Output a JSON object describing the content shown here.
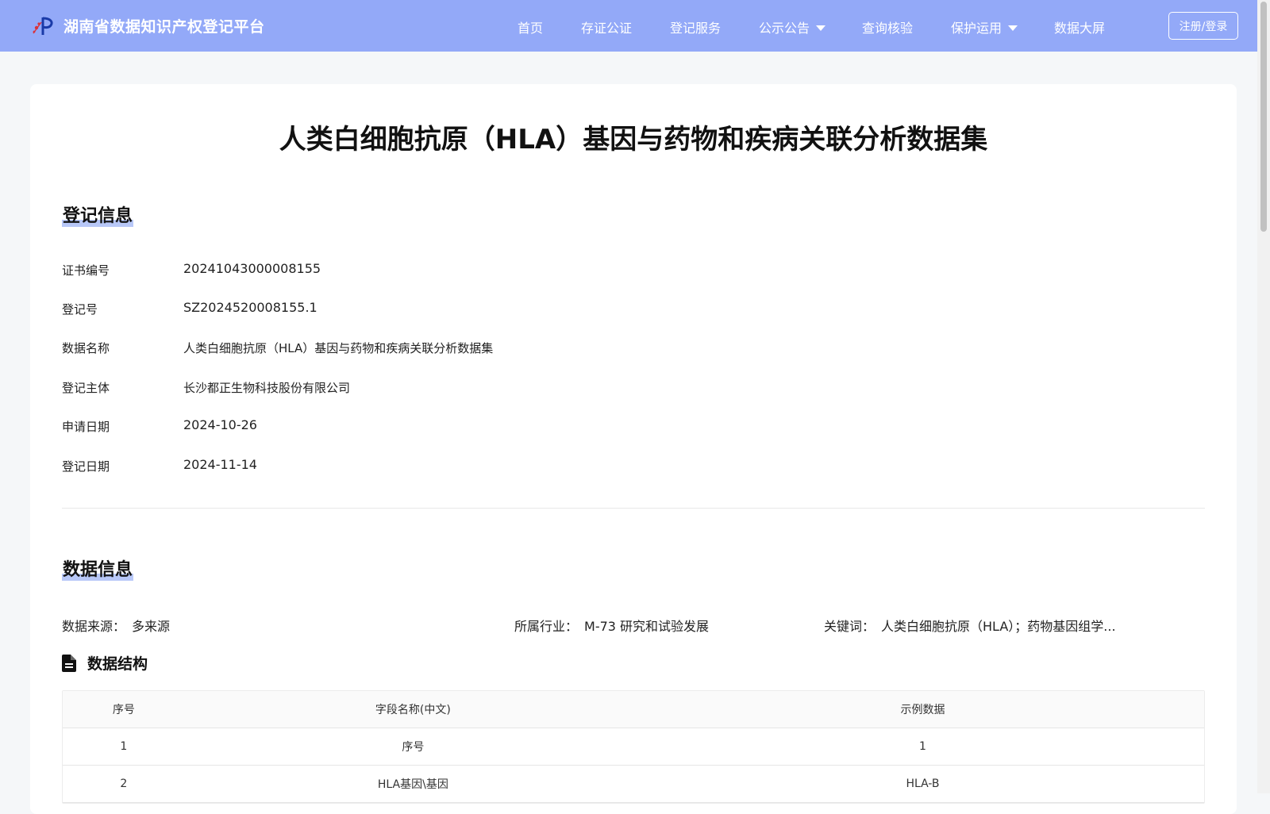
{
  "header": {
    "site_title": "湖南省数据知识产权登记平台",
    "nav": [
      {
        "label": "首页"
      },
      {
        "label": "存证公证"
      },
      {
        "label": "登记服务"
      },
      {
        "label": "公示公告",
        "dropdown": true
      },
      {
        "label": "查询核验"
      },
      {
        "label": "保护运用",
        "dropdown": true
      },
      {
        "label": "数据大屏"
      }
    ],
    "login_label": "注册/登录"
  },
  "colors": {
    "header_bg": "#93a9f8",
    "section_highlight": "#b8c8f8",
    "page_bg": "#f5f7f9"
  },
  "main": {
    "title": "人类白细胞抗原（HLA）基因与药物和疾病关联分析数据集",
    "registration": {
      "section_title": "登记信息",
      "fields": [
        {
          "label": "证书编号",
          "value": "20241043000008155"
        },
        {
          "label": "登记号",
          "value": "SZ2024520008155.1"
        },
        {
          "label": "数据名称",
          "value": "人类白细胞抗原（HLA）基因与药物和疾病关联分析数据集"
        },
        {
          "label": "登记主体",
          "value": "长沙都正生物科技股份有限公司"
        },
        {
          "label": "申请日期",
          "value": "2024-10-26"
        },
        {
          "label": "登记日期",
          "value": "2024-11-14"
        }
      ]
    },
    "data_info": {
      "section_title": "数据信息",
      "source_label": "数据来源：",
      "source_value": "多来源",
      "industry_label": "所属行业：",
      "industry_value": "M-73 研究和试验发展",
      "keywords_label": "关键词：",
      "keywords_value": "人类白细胞抗原（HLA）；药物基因组学..."
    },
    "structure": {
      "title": "数据结构",
      "icon": "document-icon",
      "columns": [
        "序号",
        "字段名称(中文)",
        "示例数据"
      ],
      "rows": [
        [
          "1",
          "序号",
          "1"
        ],
        [
          "2",
          "HLA基因\\基因",
          "HLA-B"
        ]
      ]
    }
  }
}
